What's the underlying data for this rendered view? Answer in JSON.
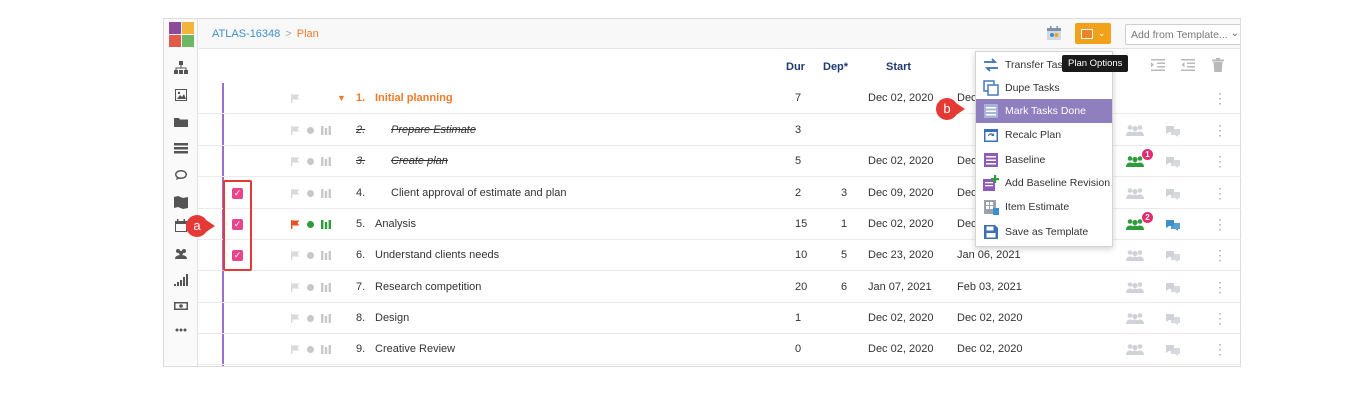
{
  "breadcrumb": {
    "project": "ATLAS-16348",
    "separator": ">",
    "current": "Plan"
  },
  "toolbar": {
    "template_select": "Add from Template...",
    "tooltip": "Plan Options"
  },
  "columns": {
    "dur": "Dur",
    "dep": "Dep*",
    "start": "Start"
  },
  "menu": {
    "items": [
      {
        "label": "Transfer Tasks",
        "icon": "transfer-icon"
      },
      {
        "label": "Dupe Tasks",
        "icon": "copy-icon"
      },
      {
        "label": "Mark Tasks Done",
        "icon": "checklist-icon",
        "active": true
      },
      {
        "label": "Recalc Plan",
        "icon": "recalc-icon"
      },
      {
        "label": "Baseline",
        "icon": "baseline-icon"
      },
      {
        "label": "Add Baseline Revision",
        "icon": "add-baseline-icon"
      },
      {
        "label": "Item Estimate",
        "icon": "estimate-icon"
      },
      {
        "label": "Save as Template",
        "icon": "save-icon"
      }
    ]
  },
  "tasks": [
    {
      "num": "1.",
      "name": "Initial planning",
      "dur": "7",
      "dep": "",
      "start": "Dec 02, 2020",
      "end": "Dec",
      "type": "phase"
    },
    {
      "num": "2.",
      "name": "Prepare Estimate",
      "dur": "3",
      "dep": "",
      "start": "",
      "end": "",
      "type": "done"
    },
    {
      "num": "3.",
      "name": "Create plan",
      "dur": "5",
      "dep": "",
      "start": "Dec 02, 2020",
      "end": "Dec",
      "type": "done",
      "badge": "1"
    },
    {
      "num": "4.",
      "name": "Client approval of estimate and plan",
      "dur": "2",
      "dep": "3",
      "start": "Dec 09, 2020",
      "end": "Dec",
      "checked": true
    },
    {
      "num": "5.",
      "name": "Analysis",
      "dur": "15",
      "dep": "1",
      "start": "Dec 02, 2020",
      "end": "Dec",
      "checked": true,
      "badge": "2"
    },
    {
      "num": "6.",
      "name": "Understand clients needs",
      "dur": "10",
      "dep": "5",
      "start": "Dec 23, 2020",
      "end": "Jan 06, 2021",
      "checked": true
    },
    {
      "num": "7.",
      "name": "Research competition",
      "dur": "20",
      "dep": "6",
      "start": "Jan 07, 2021",
      "end": "Feb 03, 2021"
    },
    {
      "num": "8.",
      "name": "Design",
      "dur": "1",
      "dep": "",
      "start": "Dec 02, 2020",
      "end": "Dec 02, 2020"
    },
    {
      "num": "9.",
      "name": "Creative Review",
      "dur": "0",
      "dep": "",
      "start": "Dec 02, 2020",
      "end": "Dec 02, 2020"
    }
  ],
  "callouts": {
    "a": "a",
    "b": "b"
  },
  "colors": {
    "accent_orange": "#f07a2b",
    "link_blue": "#3d8fcc",
    "menu_active": "#8f7fbf",
    "checkbox_pink": "#e8458d",
    "callout_red": "#e53935",
    "timeline_purple": "#9b6fce"
  }
}
